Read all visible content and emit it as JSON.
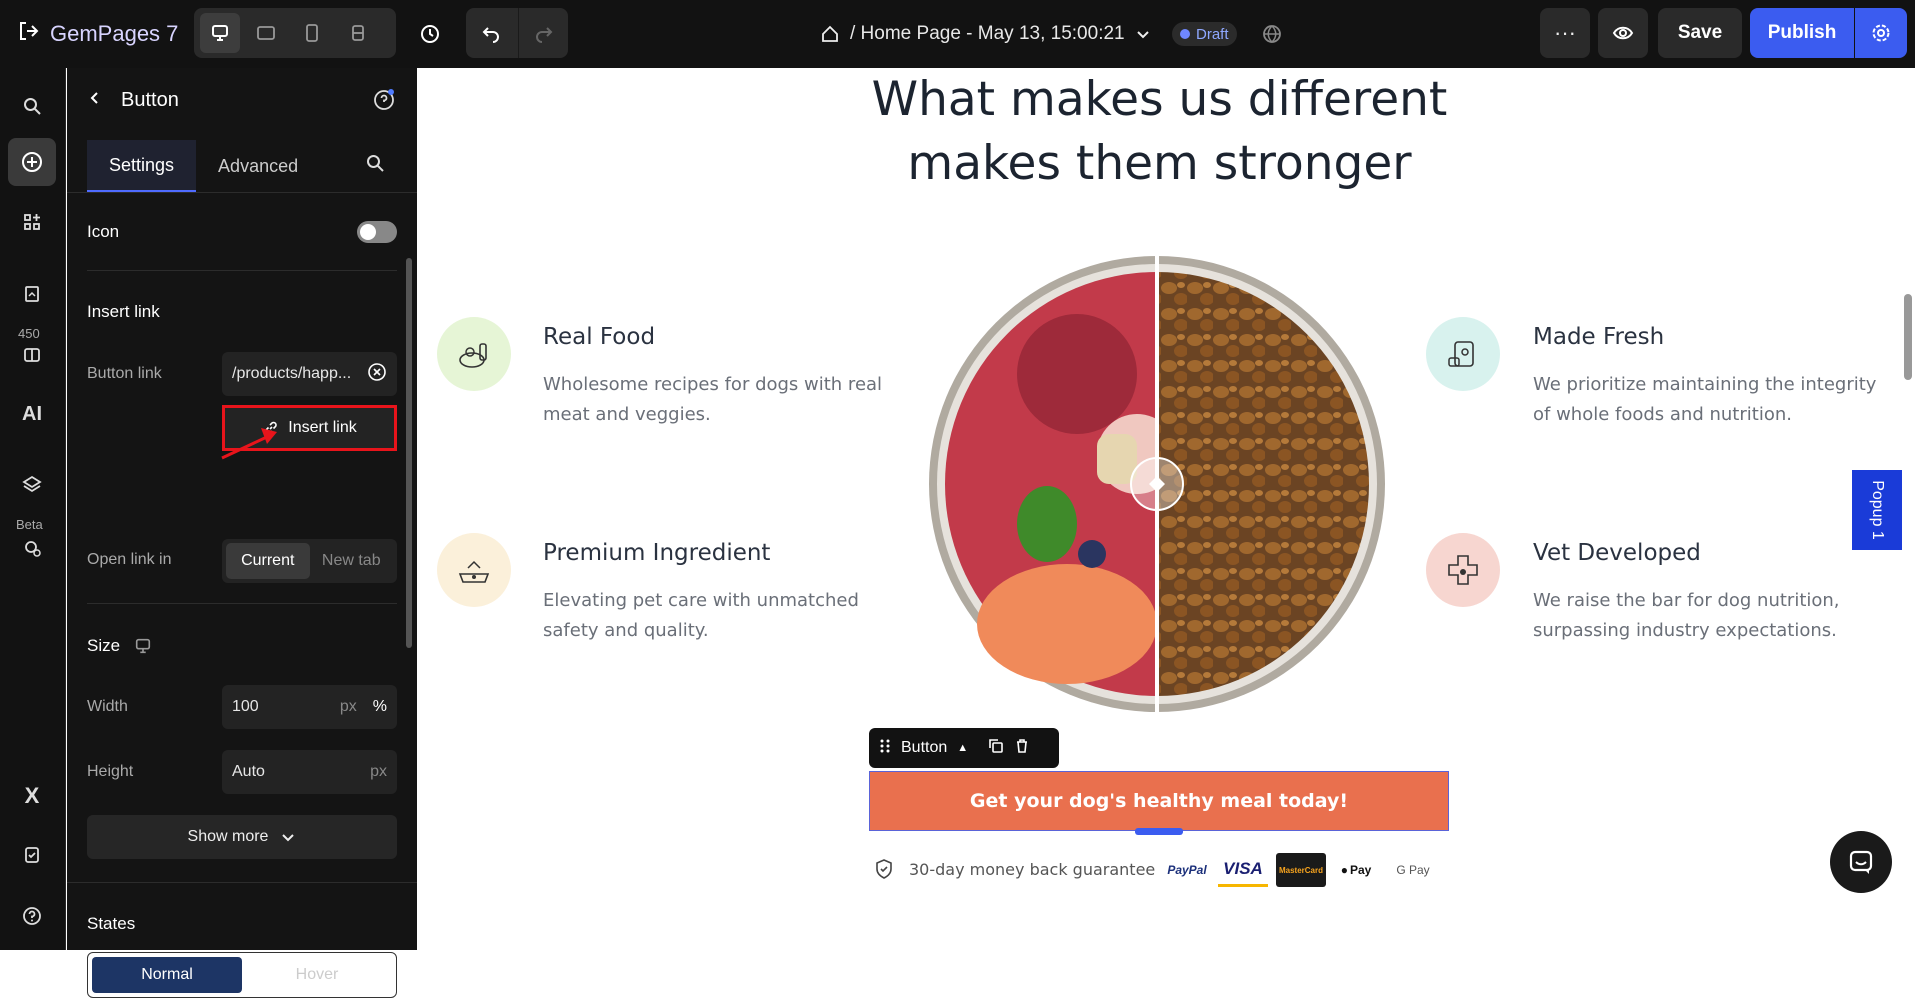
{
  "topbar": {
    "brand": "GemPages 7",
    "page_title": "/ Home Page - May 13, 15:00:21",
    "draft_label": "Draft",
    "save_label": "Save",
    "publish_label": "Publish"
  },
  "rail": {
    "count_badge": "450",
    "ai_label": "AI",
    "beta_label": "Beta"
  },
  "panel": {
    "title": "Button",
    "tabs": [
      "Settings",
      "Advanced"
    ],
    "icon_label": "Icon",
    "icon_toggle_on": false,
    "insert_link_heading": "Insert link",
    "button_link_label": "Button link",
    "button_link_value": "/products/happ...",
    "insert_link_button": "Insert link",
    "open_link_label": "Open link in",
    "open_link_options": [
      "Current",
      "New tab"
    ],
    "open_link_selected": "Current",
    "size_heading": "Size",
    "width_label": "Width",
    "width_value": "100",
    "width_units": [
      "px",
      "%"
    ],
    "width_unit_selected": "%",
    "height_label": "Height",
    "height_value": "Auto",
    "height_unit": "px",
    "show_more": "Show more",
    "states_heading": "States",
    "states_options": [
      "Normal",
      "Hover"
    ],
    "states_selected": "Normal"
  },
  "canvas": {
    "headline_line1": "What makes us different",
    "headline_line2": "makes them stronger",
    "features": [
      {
        "title": "Real Food",
        "desc_line1": "Wholesome recipes for dogs with real",
        "desc_line2": "meat and veggies.",
        "icon": "bowl-food-icon",
        "color": "#e6f5d6"
      },
      {
        "title": "Premium Ingredient",
        "desc_line1": "Elevating pet care with unmatched",
        "desc_line2": "safety and quality.",
        "icon": "dog-bowl-icon",
        "color": "#fbf0da"
      },
      {
        "title": "Made Fresh",
        "desc_line1": "We prioritize maintaining the integrity",
        "desc_line2": "of whole foods and nutrition.",
        "icon": "pet-food-bag-icon",
        "color": "#d8f2ee"
      },
      {
        "title": "Vet Developed",
        "desc_line1": "We raise the bar for dog nutrition,",
        "desc_line2": "surpassing industry expectations.",
        "icon": "vet-cross-paw-icon",
        "color": "#f7d6d0"
      }
    ],
    "toolbar_label": "Button",
    "cta_label": "Get your dog's healthy meal today!",
    "guarantee": "30-day money back guarantee",
    "payments": [
      "PayPal",
      "VISA",
      "MasterCard",
      "Pay",
      "G Pay"
    ],
    "popup_label": "Popup 1"
  },
  "colors": {
    "accent": "#3b5cf0",
    "cta": "#e9704e",
    "highlight_red": "#e8141b"
  }
}
